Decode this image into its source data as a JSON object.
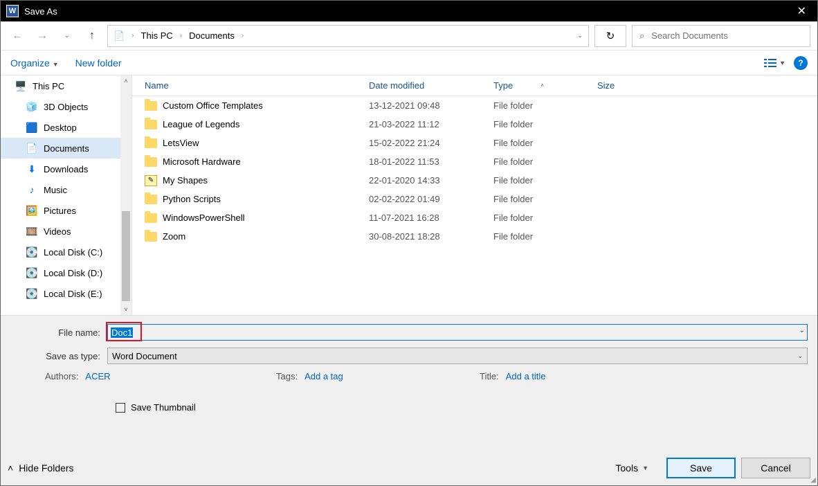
{
  "window": {
    "title": "Save As"
  },
  "nav": {
    "breadcrumb": [
      "This PC",
      "Documents"
    ],
    "search_placeholder": "Search Documents"
  },
  "toolbar": {
    "organize": "Organize",
    "new_folder": "New folder"
  },
  "sidebar": {
    "items": [
      {
        "label": "This PC",
        "icon": "pc"
      },
      {
        "label": "3D Objects",
        "icon": "3d"
      },
      {
        "label": "Desktop",
        "icon": "desktop"
      },
      {
        "label": "Documents",
        "icon": "doc",
        "selected": true
      },
      {
        "label": "Downloads",
        "icon": "down"
      },
      {
        "label": "Music",
        "icon": "music"
      },
      {
        "label": "Pictures",
        "icon": "pic"
      },
      {
        "label": "Videos",
        "icon": "vid"
      },
      {
        "label": "Local Disk (C:)",
        "icon": "disk"
      },
      {
        "label": "Local Disk (D:)",
        "icon": "disk"
      },
      {
        "label": "Local Disk (E:)",
        "icon": "disk"
      }
    ]
  },
  "columns": {
    "name": "Name",
    "date": "Date modified",
    "type": "Type",
    "size": "Size"
  },
  "files": [
    {
      "name": "Custom Office Templates",
      "date": "13-12-2021 09:48",
      "type": "File folder",
      "icon": "folder"
    },
    {
      "name": "League of Legends",
      "date": "21-03-2022 11:12",
      "type": "File folder",
      "icon": "folder"
    },
    {
      "name": "LetsView",
      "date": "15-02-2022 21:24",
      "type": "File folder",
      "icon": "folder"
    },
    {
      "name": "Microsoft Hardware",
      "date": "18-01-2022 11:53",
      "type": "File folder",
      "icon": "folder"
    },
    {
      "name": "My Shapes",
      "date": "22-01-2020 14:33",
      "type": "File folder",
      "icon": "shapes"
    },
    {
      "name": "Python Scripts",
      "date": "02-02-2022 01:49",
      "type": "File folder",
      "icon": "folder"
    },
    {
      "name": "WindowsPowerShell",
      "date": "11-07-2021 16:28",
      "type": "File folder",
      "icon": "folder"
    },
    {
      "name": "Zoom",
      "date": "30-08-2021 18:28",
      "type": "File folder",
      "icon": "folder"
    }
  ],
  "form": {
    "filename_label": "File name:",
    "filename_value": "Doc1",
    "type_label": "Save as type:",
    "type_value": "Word Document",
    "authors_label": "Authors:",
    "authors_value": "ACER",
    "tags_label": "Tags:",
    "tags_value": "Add a tag",
    "title_label": "Title:",
    "title_value": "Add a title",
    "save_thumbnail": "Save Thumbnail"
  },
  "footer": {
    "hide_folders": "Hide Folders",
    "tools": "Tools",
    "save": "Save",
    "cancel": "Cancel"
  }
}
